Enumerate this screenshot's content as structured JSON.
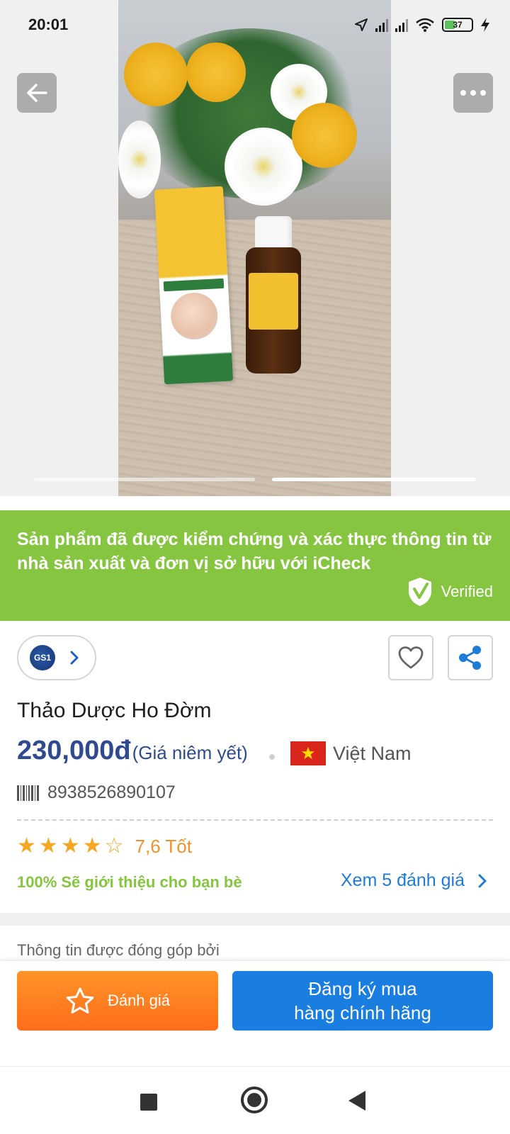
{
  "status_bar": {
    "time": "20:01",
    "battery": "37"
  },
  "hero": {
    "image_alt": "product-photo",
    "pages": 2,
    "active_page": 2
  },
  "verified_banner": {
    "message": "Sản phẩm đã được kiểm chứng và xác thực thông tin từ nhà sản xuất và đơn vị sở hữu với iCheck",
    "badge_label": "Verified",
    "color": "#86c540"
  },
  "product": {
    "gs1_label": "GS1",
    "name": "Thảo Dược Ho Đờm",
    "price": "230,000đ",
    "price_note": "(Giá niêm yết)",
    "country": "Việt Nam",
    "barcode": "8938526890107",
    "rating_stars": 4,
    "rating_max": 5,
    "rating_text": "7,6 Tốt",
    "recommend_text": "100% Sẽ giới thiệu cho bạn bè",
    "reviews_link": "Xem 5 đánh giá"
  },
  "contributor_label": "Thông tin được đóng góp bởi",
  "actions": {
    "rate_label": "Đánh giá",
    "buy_line1": "Đăng ký mua",
    "buy_line2": "hàng chính hãng"
  },
  "colors": {
    "price": "#2f4a8f",
    "link": "#1e7bd6",
    "rating": "#f0932b",
    "buy_button": "#1a7ee0",
    "rate_button": "#ff7a20"
  }
}
